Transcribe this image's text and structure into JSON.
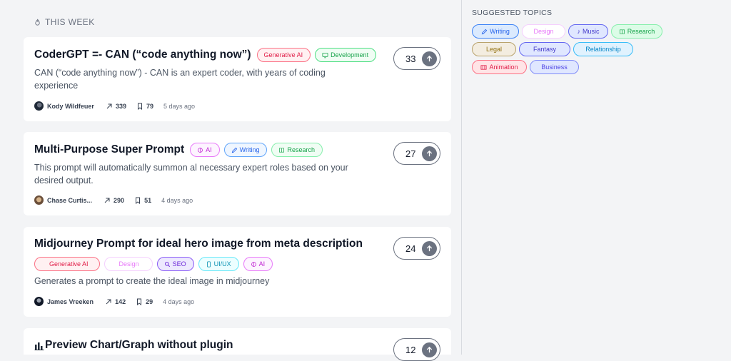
{
  "section_label": "THIS WEEK",
  "colors": {
    "generative_ai": "#e11d48",
    "development": "#16a34a",
    "ai": "#c026d3",
    "writing": "#2563eb",
    "research": "#16a34a",
    "design": "#e879f9",
    "seo": "#6d28d9",
    "uiux": "#0891b2",
    "music": "#4338ca",
    "legal": "#a16207",
    "fantasy": "#4338ca",
    "relationship": "#0284c7",
    "animation": "#e11d48",
    "business": "#4f46e5"
  },
  "prompts": [
    {
      "title": "CoderGPT =- CAN (“code anything now”)",
      "tags": [
        "Generative AI",
        "Development"
      ],
      "description": "CAN (“code anything now”) - CAN is an expert coder, with years of coding experience",
      "author": "Kody Wildfeuer",
      "shares": "339",
      "saves": "79",
      "ago": "5 days ago",
      "votes": "33"
    },
    {
      "title": "Multi-Purpose Super Prompt",
      "tags": [
        "AI",
        "Writing",
        "Research"
      ],
      "description": "This prompt will automatically summon al necessary expert roles based on your desired output.",
      "author": "Chase Curtis...",
      "shares": "290",
      "saves": "51",
      "ago": "4 days ago",
      "votes": "27"
    },
    {
      "title": "Midjourney Prompt for ideal hero image from meta description",
      "tags": [
        "Generative AI",
        "Design",
        "SEO",
        "UI/UX",
        "AI"
      ],
      "description": "Generates a prompt to create the ideal image in midjourney",
      "author": "James Vreeken",
      "shares": "142",
      "saves": "29",
      "ago": "4 days ago",
      "votes": "24"
    },
    {
      "title": "Preview Chart/Graph without plugin",
      "votes": "12"
    }
  ],
  "sidebar": {
    "title": "SUGGESTED TOPICS",
    "topics": [
      "Writing",
      "Design",
      "Music",
      "Research",
      "Legal",
      "Fantasy",
      "Relationship",
      "Animation",
      "Business"
    ]
  }
}
